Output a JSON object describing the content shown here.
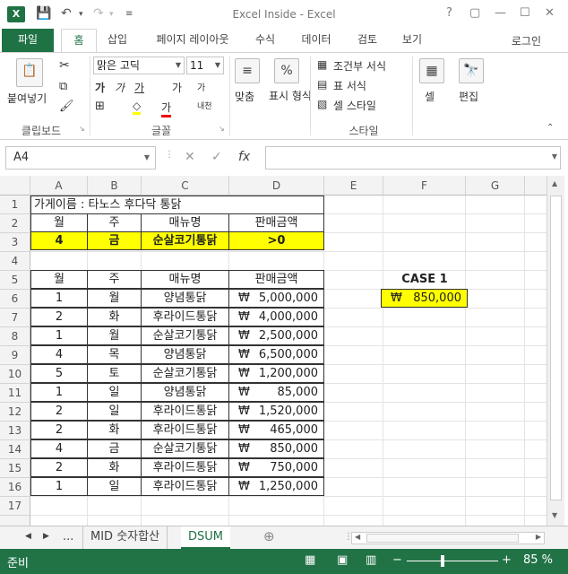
{
  "titlebar": {
    "app_icon": "X",
    "title": "Excel Inside - Excel",
    "help": "?",
    "restore": "▢",
    "minimize": "—",
    "maximize": "☐",
    "close": "✕"
  },
  "ribbon_tabs": [
    "파일",
    "홈",
    "삽입",
    "페이지 레이아웃",
    "수식",
    "데이터",
    "검토",
    "보기"
  ],
  "sign_in": "로그인",
  "ribbon": {
    "paste_label": "붙여넣기",
    "font_name": "맑은 고딕",
    "font_size": "11",
    "align_label": "맞춤",
    "number_label": "표시 형식",
    "percent_symbol": "%",
    "cond_format": "조건부 서식",
    "table_format": "표 서식",
    "cell_style": "셀 스타일",
    "cells_label": "셀",
    "edit_label": "편집",
    "group_clipboard": "클립보드",
    "group_font": "글꼴",
    "group_style": "스타일",
    "bold": "가",
    "italic": "가",
    "underline": "가",
    "grow": "가",
    "shrink": "가",
    "font_color": "가",
    "fill_symbol": "◇",
    "phonetic": "내천"
  },
  "formula_bar": {
    "name_box": "A4",
    "cancel": "✕",
    "enter": "✓",
    "fx": "fx",
    "value": ""
  },
  "columns": [
    "A",
    "B",
    "C",
    "D",
    "E",
    "F",
    "G"
  ],
  "rows": [
    "1",
    "2",
    "3",
    "4",
    "5",
    "6",
    "7",
    "8",
    "9",
    "10",
    "11",
    "12",
    "13",
    "14",
    "15",
    "16",
    "17"
  ],
  "store_title": "가게이름 : 타노스 후다닥 통닭",
  "criteria": {
    "headers": [
      "월",
      "주",
      "매뉴명",
      "판매금액"
    ],
    "values": [
      "4",
      "금",
      "순살코기통닭",
      ">0"
    ]
  },
  "table": {
    "headers": [
      "월",
      "주",
      "매뉴명",
      "판매금액"
    ],
    "currency": "₩",
    "rows": [
      [
        "1",
        "월",
        "양념통닭",
        "5,000,000"
      ],
      [
        "2",
        "화",
        "후라이드통닭",
        "4,000,000"
      ],
      [
        "1",
        "월",
        "순살코기통닭",
        "2,500,000"
      ],
      [
        "4",
        "목",
        "양념통닭",
        "6,500,000"
      ],
      [
        "5",
        "토",
        "순살코기통닭",
        "1,200,000"
      ],
      [
        "1",
        "일",
        "양념통닭",
        "85,000"
      ],
      [
        "2",
        "일",
        "후라이드통닭",
        "1,520,000"
      ],
      [
        "2",
        "화",
        "후라이드통닭",
        "465,000"
      ],
      [
        "4",
        "금",
        "순살코기통닭",
        "850,000"
      ],
      [
        "2",
        "화",
        "후라이드통닭",
        "750,000"
      ],
      [
        "1",
        "일",
        "후라이드통닭",
        "1,250,000"
      ]
    ]
  },
  "case": {
    "title": "CASE 1",
    "currency": "₩",
    "value": "850,000"
  },
  "sheet_tabs": {
    "nav_prev": "◀",
    "nav_next": "▶",
    "ellipsis": "...",
    "tabs": [
      "MID 숫자합산",
      "DSUM"
    ],
    "add": "⊕"
  },
  "status": {
    "ready": "준비",
    "zoom_minus": "−",
    "zoom_plus": "+",
    "zoom": "85 %"
  }
}
